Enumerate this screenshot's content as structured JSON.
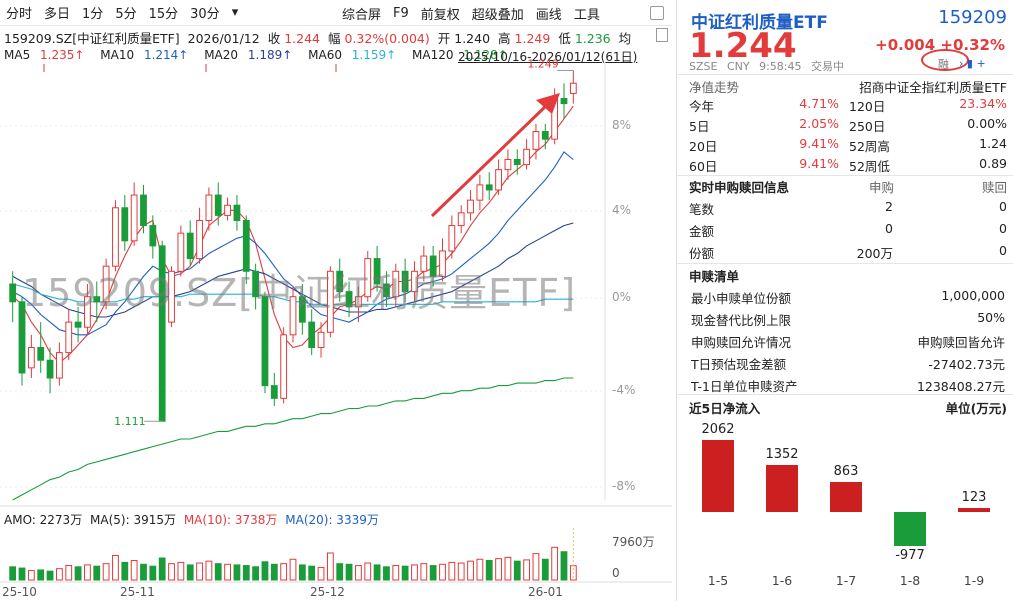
{
  "toolbar": {
    "timeframes": [
      "分时",
      "多日",
      "1分",
      "5分",
      "15分",
      "30分"
    ],
    "tools": [
      "综合屏",
      "F9",
      "前复权",
      "超级叠加",
      "画线",
      "工具"
    ]
  },
  "info": {
    "symbol": "159209.SZ[中证红利质量ETF]",
    "date": "2026/01/12",
    "close_label": "收",
    "close": "1.244",
    "amp_label": "幅",
    "amp": "0.32%(0.004)",
    "open_label": "开",
    "open": "1.240",
    "high_label": "高",
    "high": "1.249",
    "low_label": "低",
    "low": "1.236",
    "avg_label": "均"
  },
  "ma": [
    {
      "label": "MA5",
      "value": "1.235↑",
      "color": "#e23b3b"
    },
    {
      "label": "MA10",
      "value": "1.214↑",
      "color": "#1f5fc4"
    },
    {
      "label": "MA20",
      "value": "1.189↑",
      "color": "#2b3f8f"
    },
    {
      "label": "MA60",
      "value": "1.159↑",
      "color": "#2bb3d6"
    },
    {
      "label": "MA120",
      "value": "1.128↑",
      "color": "#1a9c3a"
    }
  ],
  "range": "2025/10/16-2026/01/12(61日)",
  "watermark": "159209.SZ[中证红利质量ETF]",
  "chart": {
    "pct_ticks": [
      "8%",
      "4%",
      "0%",
      "-4%",
      "-8%"
    ],
    "high_marker": "1.249",
    "low_marker": "1.111",
    "date_ticks": [
      "25-10",
      "25-11",
      "25-12",
      "26-01"
    ]
  },
  "chart_data": {
    "type": "candlestick",
    "series": [
      {
        "name": "K线",
        "values": [
          [
            1.165,
            1.158,
            1.17,
            1.15
          ],
          [
            1.158,
            1.13,
            1.16,
            1.125
          ],
          [
            1.132,
            1.14,
            1.145,
            1.128
          ],
          [
            1.14,
            1.135,
            1.15,
            1.13
          ],
          [
            1.135,
            1.128,
            1.14,
            1.122
          ],
          [
            1.128,
            1.138,
            1.142,
            1.125
          ],
          [
            1.138,
            1.15,
            1.155,
            1.135
          ],
          [
            1.15,
            1.148,
            1.156,
            1.142
          ],
          [
            1.148,
            1.16,
            1.165,
            1.145
          ],
          [
            1.16,
            1.158,
            1.166,
            1.15
          ],
          [
            1.158,
            1.172,
            1.175,
            1.155
          ],
          [
            1.172,
            1.195,
            1.198,
            1.17
          ],
          [
            1.195,
            1.182,
            1.2,
            1.178
          ],
          [
            1.182,
            1.2,
            1.205,
            1.18
          ],
          [
            1.2,
            1.188,
            1.204,
            1.185
          ],
          [
            1.188,
            1.18,
            1.192,
            1.175
          ],
          [
            1.18,
            1.111,
            1.182,
            1.111
          ],
          [
            1.15,
            1.17,
            1.172,
            1.148
          ],
          [
            1.17,
            1.185,
            1.188,
            1.168
          ],
          [
            1.185,
            1.175,
            1.19,
            1.172
          ],
          [
            1.175,
            1.19,
            1.195,
            1.173
          ],
          [
            1.19,
            1.2,
            1.203,
            1.186
          ],
          [
            1.2,
            1.192,
            1.205,
            1.188
          ],
          [
            1.192,
            1.196,
            1.199,
            1.19
          ],
          [
            1.196,
            1.19,
            1.2,
            1.186
          ],
          [
            1.19,
            1.17,
            1.192,
            1.165
          ],
          [
            1.17,
            1.16,
            1.173,
            1.155
          ],
          [
            1.16,
            1.125,
            1.162,
            1.122
          ],
          [
            1.125,
            1.12,
            1.13,
            1.117
          ],
          [
            1.12,
            1.145,
            1.148,
            1.118
          ],
          [
            1.145,
            1.16,
            1.164,
            1.142
          ],
          [
            1.16,
            1.15,
            1.165,
            1.145
          ],
          [
            1.15,
            1.14,
            1.155,
            1.137
          ],
          [
            1.14,
            1.146,
            1.15,
            1.136
          ],
          [
            1.146,
            1.17,
            1.172,
            1.144
          ],
          [
            1.17,
            1.162,
            1.175,
            1.158
          ],
          [
            1.162,
            1.156,
            1.166,
            1.152
          ],
          [
            1.156,
            1.16,
            1.164,
            1.15
          ],
          [
            1.16,
            1.175,
            1.178,
            1.158
          ],
          [
            1.175,
            1.165,
            1.18,
            1.162
          ],
          [
            1.165,
            1.16,
            1.17,
            1.156
          ],
          [
            1.16,
            1.17,
            1.173,
            1.156
          ],
          [
            1.17,
            1.162,
            1.175,
            1.158
          ],
          [
            1.162,
            1.17,
            1.174,
            1.158
          ],
          [
            1.17,
            1.176,
            1.18,
            1.166
          ],
          [
            1.176,
            1.168,
            1.18,
            1.164
          ],
          [
            1.168,
            1.178,
            1.183,
            1.166
          ],
          [
            1.178,
            1.188,
            1.192,
            1.175
          ],
          [
            1.188,
            1.193,
            1.196,
            1.185
          ],
          [
            1.193,
            1.198,
            1.202,
            1.19
          ],
          [
            1.198,
            1.204,
            1.208,
            1.194
          ],
          [
            1.204,
            1.202,
            1.209,
            1.198
          ],
          [
            1.202,
            1.21,
            1.214,
            1.2
          ],
          [
            1.21,
            1.214,
            1.218,
            1.206
          ],
          [
            1.214,
            1.212,
            1.218,
            1.208
          ],
          [
            1.212,
            1.218,
            1.222,
            1.21
          ],
          [
            1.218,
            1.225,
            1.228,
            1.214
          ],
          [
            1.225,
            1.222,
            1.228,
            1.218
          ],
          [
            1.222,
            1.238,
            1.242,
            1.22
          ],
          [
            1.238,
            1.236,
            1.244,
            1.23
          ],
          [
            1.24,
            1.244,
            1.249,
            1.236
          ]
        ]
      },
      {
        "name": "MA5",
        "values": [
          1.16,
          1.157,
          1.15,
          1.145,
          1.138,
          1.134,
          1.137,
          1.141,
          1.145,
          1.151,
          1.158,
          1.168,
          1.176,
          1.183,
          1.188,
          1.19,
          1.175,
          1.168,
          1.169,
          1.172,
          1.18,
          1.188,
          1.191,
          1.194,
          1.194,
          1.19,
          1.181,
          1.167,
          1.153,
          1.144,
          1.14,
          1.141,
          1.145,
          1.148,
          1.152,
          1.156,
          1.157,
          1.159,
          1.162,
          1.164,
          1.163,
          1.166,
          1.166,
          1.167,
          1.17,
          1.171,
          1.173,
          1.177,
          1.182,
          1.188,
          1.193,
          1.197,
          1.202,
          1.207,
          1.21,
          1.213,
          1.217,
          1.22,
          1.225,
          1.23,
          1.235
        ]
      },
      {
        "name": "MA10",
        "values": [
          1.162,
          1.16,
          1.157,
          1.153,
          1.15,
          1.147,
          1.146,
          1.145,
          1.145,
          1.147,
          1.149,
          1.154,
          1.158,
          1.163,
          1.168,
          1.172,
          1.17,
          1.169,
          1.17,
          1.171,
          1.174,
          1.177,
          1.179,
          1.181,
          1.183,
          1.184,
          1.181,
          1.177,
          1.172,
          1.167,
          1.164,
          1.16,
          1.156,
          1.153,
          1.152,
          1.151,
          1.15,
          1.152,
          1.154,
          1.157,
          1.159,
          1.16,
          1.161,
          1.163,
          1.165,
          1.166,
          1.167,
          1.169,
          1.172,
          1.175,
          1.178,
          1.181,
          1.185,
          1.19,
          1.194,
          1.198,
          1.202,
          1.206,
          1.211,
          1.217,
          1.214
        ]
      },
      {
        "name": "MA20",
        "values": [
          1.168,
          1.166,
          1.164,
          1.161,
          1.159,
          1.157,
          1.155,
          1.154,
          1.153,
          1.152,
          1.152,
          1.153,
          1.154,
          1.156,
          1.158,
          1.16,
          1.16,
          1.16,
          1.161,
          1.162,
          1.164,
          1.166,
          1.168,
          1.169,
          1.17,
          1.171,
          1.17,
          1.169,
          1.167,
          1.165,
          1.163,
          1.161,
          1.159,
          1.157,
          1.156,
          1.155,
          1.154,
          1.154,
          1.154,
          1.155,
          1.155,
          1.156,
          1.157,
          1.158,
          1.159,
          1.16,
          1.161,
          1.162,
          1.164,
          1.166,
          1.168,
          1.17,
          1.172,
          1.175,
          1.177,
          1.18,
          1.182,
          1.184,
          1.186,
          1.188,
          1.189
        ]
      },
      {
        "name": "MA60",
        "values": [
          1.165,
          1.164,
          1.163,
          1.161,
          1.16,
          1.159,
          1.159,
          1.158,
          1.158,
          1.158,
          1.158,
          1.158,
          1.159,
          1.159,
          1.16,
          1.16,
          1.16,
          1.16,
          1.16,
          1.161,
          1.161,
          1.161,
          1.161,
          1.161,
          1.161,
          1.161,
          1.161,
          1.16,
          1.16,
          1.159,
          1.158,
          1.158,
          1.157,
          1.157,
          1.157,
          1.157,
          1.157,
          1.157,
          1.157,
          1.157,
          1.157,
          1.157,
          1.157,
          1.157,
          1.157,
          1.157,
          1.158,
          1.158,
          1.158,
          1.158,
          1.158,
          1.158,
          1.158,
          1.158,
          1.158,
          1.158,
          1.158,
          1.159,
          1.159,
          1.159,
          1.159
        ]
      },
      {
        "name": "MA120",
        "values": [
          1.08,
          1.082,
          1.084,
          1.086,
          1.088,
          1.089,
          1.091,
          1.092,
          1.094,
          1.095,
          1.096,
          1.097,
          1.098,
          1.099,
          1.1,
          1.101,
          1.102,
          1.103,
          1.104,
          1.104,
          1.105,
          1.106,
          1.107,
          1.107,
          1.108,
          1.109,
          1.109,
          1.11,
          1.11,
          1.111,
          1.112,
          1.112,
          1.113,
          1.114,
          1.114,
          1.115,
          1.116,
          1.116,
          1.117,
          1.117,
          1.118,
          1.119,
          1.119,
          1.12,
          1.12,
          1.121,
          1.122,
          1.122,
          1.123,
          1.123,
          1.124,
          1.124,
          1.125,
          1.125,
          1.126,
          1.126,
          1.126,
          1.127,
          1.127,
          1.128,
          1.128
        ]
      }
    ],
    "ylim": [
      1.08,
      1.25
    ],
    "volume": [
      2100,
      1900,
      1500,
      1600,
      1400,
      1800,
      2300,
      2100,
      2400,
      2200,
      2600,
      3900,
      2800,
      3100,
      2500,
      2200,
      3500,
      2600,
      2800,
      2400,
      2700,
      3000,
      2600,
      2500,
      2400,
      2300,
      2100,
      2900,
      2500,
      2600,
      3300,
      2400,
      2200,
      2000,
      4300,
      2600,
      2500,
      2300,
      2700,
      2400,
      2100,
      2300,
      2200,
      2400,
      2600,
      2300,
      2500,
      2800,
      2700,
      3000,
      3300,
      3100,
      3400,
      3600,
      3000,
      3200,
      4200,
      3300,
      5200,
      4500,
      2273
    ],
    "volume_max_label": "7960万",
    "volume_zero_label": "0"
  },
  "amo": {
    "label": "AMO: 2273万",
    "ma5": "MA(5): 3915万",
    "ma10": "MA(10): 3738万",
    "ma20": "MA(20): 3339万"
  },
  "panel": {
    "name": "中证红利质量ETF",
    "code": "159209",
    "price": "1.244",
    "change": "+0.004",
    "change_pct": "+0.32%",
    "meta": [
      "SZSE",
      "CNY",
      "9:58:45",
      "交易中"
    ],
    "rong": "融",
    "nav_trend": "净值走势",
    "fund_company": "招商中证全指红利质量ETF",
    "perf": [
      [
        "今年",
        "4.71%",
        "120日",
        "23.34%"
      ],
      [
        "5日",
        "2.05%",
        "250日",
        "0.00%"
      ],
      [
        "20日",
        "9.41%",
        "52周高",
        "1.24"
      ],
      [
        "60日",
        "9.41%",
        "52周低",
        "0.89"
      ]
    ],
    "realtime_title": "实时申购赎回信息",
    "realtime_cols": [
      "申购",
      "赎回"
    ],
    "realtime_rows": [
      [
        "笔数",
        "2",
        "0"
      ],
      [
        "金额",
        "0",
        "0"
      ],
      [
        "份额",
        "200万",
        "0"
      ]
    ],
    "list_title": "申赎清单",
    "list_rows": [
      [
        "最小申赎单位份额",
        "1,000,000"
      ],
      [
        "现金替代比例上限",
        "50%"
      ],
      [
        "申购赎回允许情况",
        "申购赎回皆允许"
      ],
      [
        "T日预估现金差额",
        "-27402.73元"
      ],
      [
        "T-1日单位申赎资产",
        "1238408.27元"
      ]
    ],
    "flow_title": "近5日净流入",
    "flow_unit": "单位(万元)",
    "flow": [
      {
        "date": "1-5",
        "value": 2062
      },
      {
        "date": "1-6",
        "value": 1352
      },
      {
        "date": "1-7",
        "value": 863
      },
      {
        "date": "1-8",
        "value": -977
      },
      {
        "date": "1-9",
        "value": 123
      }
    ],
    "flow_labels": [
      "2062",
      "1352",
      "863",
      "-977",
      "123"
    ]
  },
  "colors": {
    "up": "#e23b3b",
    "down": "#1a9c3a",
    "accent": "#1f5fc4"
  }
}
